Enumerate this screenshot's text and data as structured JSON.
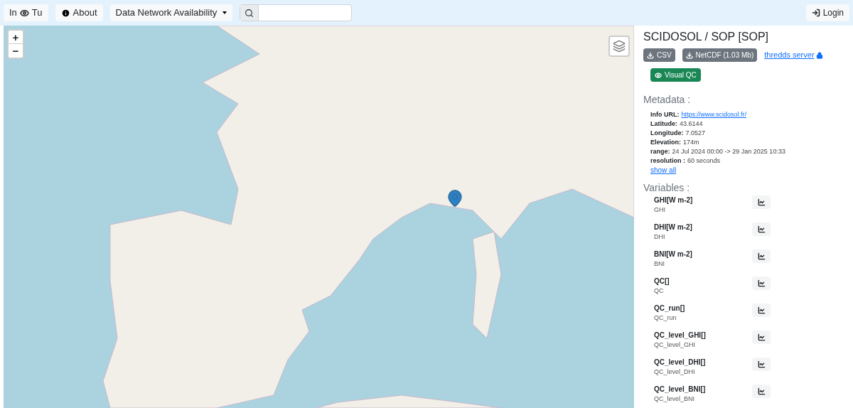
{
  "navbar": {
    "items": [
      {
        "kind": "brand",
        "label": "In",
        "label2": "Tu"
      },
      {
        "kind": "about",
        "label": "About"
      },
      {
        "kind": "dropdown",
        "label": "Data Network Availability"
      }
    ],
    "login": "Login"
  },
  "map": {
    "zoom_in": "+",
    "zoom_out": "−"
  },
  "panel": {
    "title": "SCIDOSOL / SOP [SOP]",
    "downloads": [
      {
        "label": "CSV"
      },
      {
        "label": "NetCDF (1.03 Mb)"
      }
    ],
    "thredds": "thredds server",
    "visual_qc": "Visual QC",
    "metadata_heading": "Metadata :",
    "metadata": [
      {
        "label": "Info URL:",
        "value": "https://www.scidosol.fr/",
        "kind": "link"
      },
      {
        "label": "Latitude:",
        "value": "43.6144",
        "kind": "text"
      },
      {
        "label": "Longitude:",
        "value": "7.0527",
        "kind": "text"
      },
      {
        "label": "Elevation:",
        "value": "174m",
        "kind": "text"
      },
      {
        "label": "range:",
        "value": "24 Jul 2024 00:00 -> 29 Jan 2025 10:33",
        "kind": "text"
      },
      {
        "label": "resolution :",
        "value": "60 seconds",
        "kind": "text"
      }
    ],
    "show_all": "show all",
    "variables_heading": "Variables :",
    "variables": [
      {
        "name": "GHI[W m-2]",
        "short": "GHI"
      },
      {
        "name": "DHI[W m-2]",
        "short": "DHI"
      },
      {
        "name": "BNI[W m-2]",
        "short": "BNI"
      },
      {
        "name": "QC[]",
        "short": "QC"
      },
      {
        "name": "QC_run[]",
        "short": "QC_run"
      },
      {
        "name": "QC_level_GHI[]",
        "short": "QC_level_GHI"
      },
      {
        "name": "QC_level_DHI[]",
        "short": "QC_level_DHI"
      },
      {
        "name": "QC_level_BNI[]",
        "short": "QC_level_BNI"
      }
    ]
  }
}
